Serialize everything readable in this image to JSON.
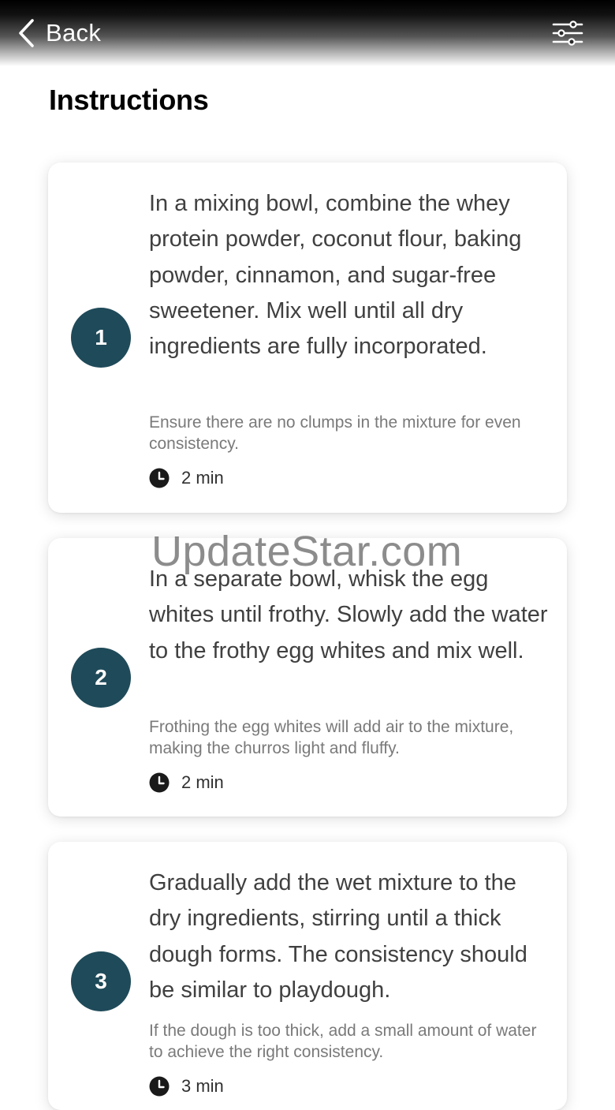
{
  "header": {
    "back_label": "Back",
    "back_icon": "chevron-left-icon",
    "filter_icon": "sliders-icon"
  },
  "page": {
    "title": "Instructions"
  },
  "steps": [
    {
      "number": "1",
      "text": "In a mixing bowl, combine the whey protein powder, coconut flour, baking powder, cinnamon, and sugar-free sweetener. Mix well until all dry ingredients are fully incorporated.",
      "tip": "Ensure there are no clumps in the mixture for even consistency.",
      "time": "2 min"
    },
    {
      "number": "2",
      "text": "In a separate bowl, whisk the egg whites until frothy. Slowly add the water to the frothy egg whites and mix well.",
      "tip": "Frothing the egg whites will add air to the mixture, making the churros light and fluffy.",
      "time": "2 min"
    },
    {
      "number": "3",
      "text": "Gradually add the wet mixture to the dry ingredients, stirring until a thick dough forms. The consistency should be similar to playdough.",
      "tip": "If the dough is too thick, add a small amount of water to achieve the right consistency.",
      "time": "3 min"
    }
  ],
  "watermark": "UpdateStar.com",
  "colors": {
    "badge": "#1f4a59",
    "step_text": "#404040",
    "tip_text": "#7a7a7a"
  }
}
